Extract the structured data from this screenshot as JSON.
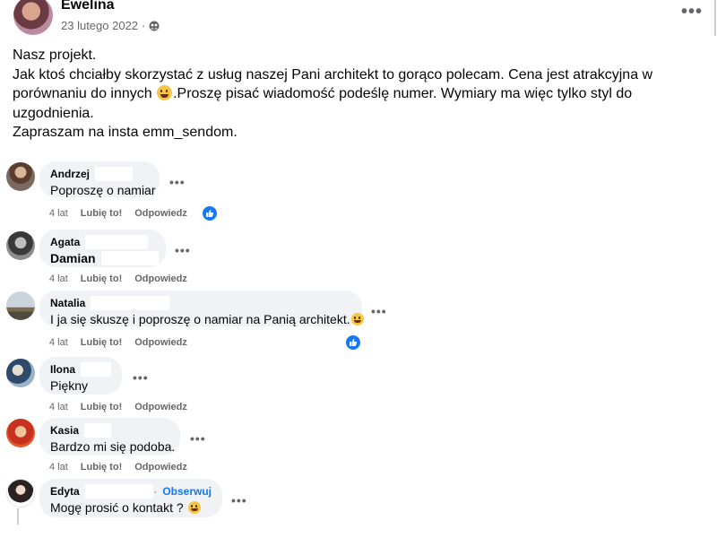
{
  "post": {
    "author": "Ewelina",
    "date": "23 lutego 2022",
    "audience_icon": "friends-icon",
    "lines": [
      {
        "text": "Nasz projekt."
      },
      {
        "text": "Jak ktoś chciałby skorzystać z usług naszej Pani architekt to gorąco polecam. Cena jest atrakcyjna w"
      },
      {
        "before": "porównaniu do innych ",
        "after": ".Proszę pisać wiadomość podeślę numer. Wymiary ma więc tylko styl do"
      },
      {
        "text": "uzgodnienia."
      },
      {
        "text": "Zapraszam na insta emm_sendom."
      }
    ]
  },
  "comments": [
    {
      "name": "Andrzej",
      "text": "Poproszę o namiar",
      "age": "4 lat",
      "like": "Lubię to!",
      "reply": "Odpowiedz",
      "liked": true
    },
    {
      "name": "Agata",
      "text": "Damian",
      "age": "4 lat",
      "like": "Lubię to!",
      "reply": "Odpowiedz",
      "liked": false
    },
    {
      "name": "Natalia",
      "text": "I ja się skuszę i poproszę o namiar na Panią architekt.",
      "age": "4 lat",
      "like": "Lubię to!",
      "reply": "Odpowiedz",
      "liked": true
    },
    {
      "name": "Ilona",
      "text": "Piękny",
      "age": "4 lat",
      "like": "Lubię to!",
      "reply": "Odpowiedz",
      "liked": false
    },
    {
      "name": "Kasia",
      "text": "Bardzo mi się podoba.",
      "age": "4 lat",
      "like": "Lubię to!",
      "reply": "Odpowiedz",
      "liked": false
    },
    {
      "name": "Edyta",
      "follow": "Obserwuj",
      "text": "Mogę prosić o kontakt ?",
      "liked": false
    }
  ],
  "colors": {
    "accent": "#1877f2",
    "bubble": "#f0f2f5",
    "muted": "#65676b"
  }
}
